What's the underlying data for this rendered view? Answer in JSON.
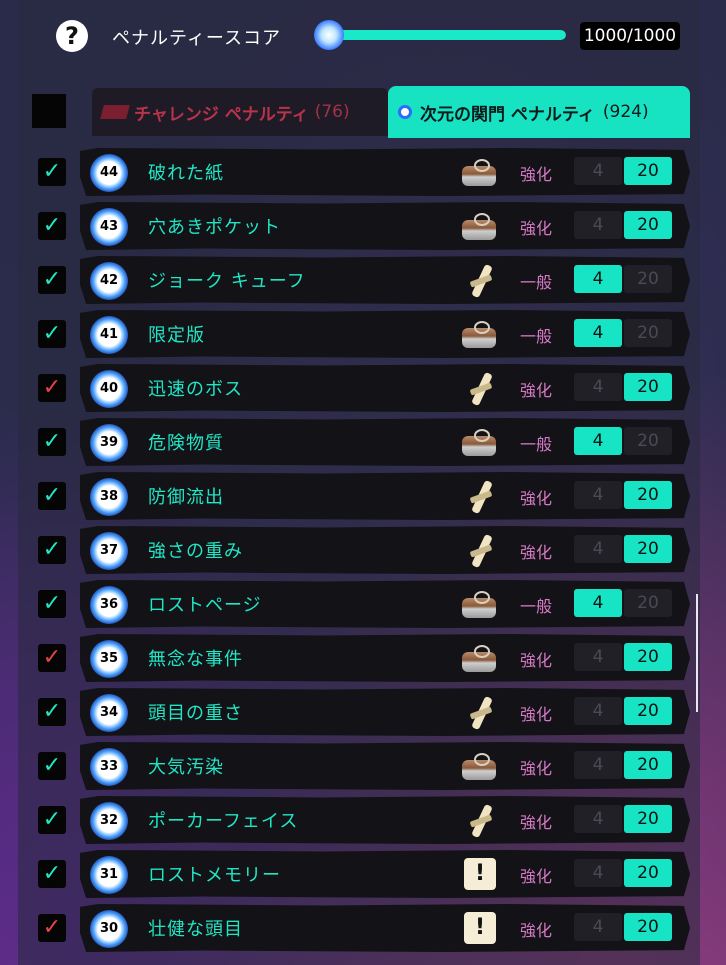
{
  "header": {
    "help_icon": "question-icon",
    "score_label": "ペナルティースコア",
    "score_value": "1000/1000",
    "score_fraction": 1.0
  },
  "tabs": [
    {
      "label": "チャレンジ ペナルティ",
      "count": "(76)",
      "active": false
    },
    {
      "label": "次元の関門 ペナルティ",
      "count": "(924)",
      "active": true
    }
  ],
  "rows": [
    {
      "checked": true,
      "check_color": "#20e8c4",
      "level": "44",
      "name": "破れた紙",
      "icon": "can-icon",
      "type": "強化",
      "val_a": "4",
      "val_b": "20",
      "selected": "b"
    },
    {
      "checked": true,
      "check_color": "#20e8c4",
      "level": "43",
      "name": "穴あきポケット",
      "icon": "can-icon",
      "type": "強化",
      "val_a": "4",
      "val_b": "20",
      "selected": "b"
    },
    {
      "checked": true,
      "check_color": "#20e8c4",
      "level": "42",
      "name": "ジョーク キューフ",
      "icon": "wheat-icon",
      "type": "一般",
      "val_a": "4",
      "val_b": "20",
      "selected": "a"
    },
    {
      "checked": true,
      "check_color": "#20e8c4",
      "level": "41",
      "name": "限定版",
      "icon": "can-icon",
      "type": "一般",
      "val_a": "4",
      "val_b": "20",
      "selected": "a"
    },
    {
      "checked": true,
      "check_color": "#e8434a",
      "level": "40",
      "name": "迅速のボス",
      "icon": "wheat-icon",
      "type": "強化",
      "val_a": "4",
      "val_b": "20",
      "selected": "b"
    },
    {
      "checked": true,
      "check_color": "#20e8c4",
      "level": "39",
      "name": "危険物質",
      "icon": "can-icon",
      "type": "一般",
      "val_a": "4",
      "val_b": "20",
      "selected": "a"
    },
    {
      "checked": true,
      "check_color": "#20e8c4",
      "level": "38",
      "name": "防御流出",
      "icon": "wheat-icon",
      "type": "強化",
      "val_a": "4",
      "val_b": "20",
      "selected": "b"
    },
    {
      "checked": true,
      "check_color": "#20e8c4",
      "level": "37",
      "name": "強さの重み",
      "icon": "wheat-icon",
      "type": "強化",
      "val_a": "4",
      "val_b": "20",
      "selected": "b"
    },
    {
      "checked": true,
      "check_color": "#20e8c4",
      "level": "36",
      "name": "ロストページ",
      "icon": "can-icon",
      "type": "一般",
      "val_a": "4",
      "val_b": "20",
      "selected": "a"
    },
    {
      "checked": true,
      "check_color": "#e8434a",
      "level": "35",
      "name": "無念な事件",
      "icon": "can-icon",
      "type": "強化",
      "val_a": "4",
      "val_b": "20",
      "selected": "b"
    },
    {
      "checked": true,
      "check_color": "#20e8c4",
      "level": "34",
      "name": "頭目の重さ",
      "icon": "wheat-icon",
      "type": "強化",
      "val_a": "4",
      "val_b": "20",
      "selected": "b"
    },
    {
      "checked": true,
      "check_color": "#20e8c4",
      "level": "33",
      "name": "大気汚染",
      "icon": "can-icon",
      "type": "強化",
      "val_a": "4",
      "val_b": "20",
      "selected": "b"
    },
    {
      "checked": true,
      "check_color": "#20e8c4",
      "level": "32",
      "name": "ポーカーフェイス",
      "icon": "wheat-icon",
      "type": "強化",
      "val_a": "4",
      "val_b": "20",
      "selected": "b"
    },
    {
      "checked": true,
      "check_color": "#20e8c4",
      "level": "31",
      "name": "ロストメモリー",
      "icon": "alert-icon",
      "type": "強化",
      "val_a": "4",
      "val_b": "20",
      "selected": "b"
    },
    {
      "checked": true,
      "check_color": "#e8434a",
      "level": "30",
      "name": "壮健な頭目",
      "icon": "alert-icon",
      "type": "強化",
      "val_a": "4",
      "val_b": "20",
      "selected": "b"
    }
  ]
}
